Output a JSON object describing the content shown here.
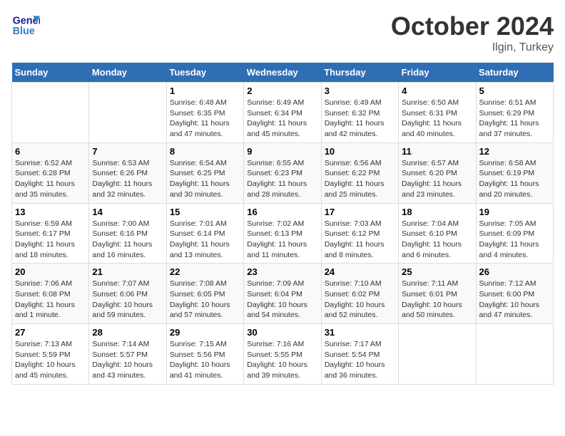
{
  "logo": {
    "line1": "General",
    "line2": "Blue"
  },
  "title": "October 2024",
  "location": "Ilgin, Turkey",
  "days_of_week": [
    "Sunday",
    "Monday",
    "Tuesday",
    "Wednesday",
    "Thursday",
    "Friday",
    "Saturday"
  ],
  "weeks": [
    [
      {
        "day": "",
        "info": ""
      },
      {
        "day": "",
        "info": ""
      },
      {
        "day": "1",
        "info": "Sunrise: 6:48 AM\nSunset: 6:35 PM\nDaylight: 11 hours and 47 minutes."
      },
      {
        "day": "2",
        "info": "Sunrise: 6:49 AM\nSunset: 6:34 PM\nDaylight: 11 hours and 45 minutes."
      },
      {
        "day": "3",
        "info": "Sunrise: 6:49 AM\nSunset: 6:32 PM\nDaylight: 11 hours and 42 minutes."
      },
      {
        "day": "4",
        "info": "Sunrise: 6:50 AM\nSunset: 6:31 PM\nDaylight: 11 hours and 40 minutes."
      },
      {
        "day": "5",
        "info": "Sunrise: 6:51 AM\nSunset: 6:29 PM\nDaylight: 11 hours and 37 minutes."
      }
    ],
    [
      {
        "day": "6",
        "info": "Sunrise: 6:52 AM\nSunset: 6:28 PM\nDaylight: 11 hours and 35 minutes."
      },
      {
        "day": "7",
        "info": "Sunrise: 6:53 AM\nSunset: 6:26 PM\nDaylight: 11 hours and 32 minutes."
      },
      {
        "day": "8",
        "info": "Sunrise: 6:54 AM\nSunset: 6:25 PM\nDaylight: 11 hours and 30 minutes."
      },
      {
        "day": "9",
        "info": "Sunrise: 6:55 AM\nSunset: 6:23 PM\nDaylight: 11 hours and 28 minutes."
      },
      {
        "day": "10",
        "info": "Sunrise: 6:56 AM\nSunset: 6:22 PM\nDaylight: 11 hours and 25 minutes."
      },
      {
        "day": "11",
        "info": "Sunrise: 6:57 AM\nSunset: 6:20 PM\nDaylight: 11 hours and 23 minutes."
      },
      {
        "day": "12",
        "info": "Sunrise: 6:58 AM\nSunset: 6:19 PM\nDaylight: 11 hours and 20 minutes."
      }
    ],
    [
      {
        "day": "13",
        "info": "Sunrise: 6:59 AM\nSunset: 6:17 PM\nDaylight: 11 hours and 18 minutes."
      },
      {
        "day": "14",
        "info": "Sunrise: 7:00 AM\nSunset: 6:16 PM\nDaylight: 11 hours and 16 minutes."
      },
      {
        "day": "15",
        "info": "Sunrise: 7:01 AM\nSunset: 6:14 PM\nDaylight: 11 hours and 13 minutes."
      },
      {
        "day": "16",
        "info": "Sunrise: 7:02 AM\nSunset: 6:13 PM\nDaylight: 11 hours and 11 minutes."
      },
      {
        "day": "17",
        "info": "Sunrise: 7:03 AM\nSunset: 6:12 PM\nDaylight: 11 hours and 8 minutes."
      },
      {
        "day": "18",
        "info": "Sunrise: 7:04 AM\nSunset: 6:10 PM\nDaylight: 11 hours and 6 minutes."
      },
      {
        "day": "19",
        "info": "Sunrise: 7:05 AM\nSunset: 6:09 PM\nDaylight: 11 hours and 4 minutes."
      }
    ],
    [
      {
        "day": "20",
        "info": "Sunrise: 7:06 AM\nSunset: 6:08 PM\nDaylight: 11 hours and 1 minute."
      },
      {
        "day": "21",
        "info": "Sunrise: 7:07 AM\nSunset: 6:06 PM\nDaylight: 10 hours and 59 minutes."
      },
      {
        "day": "22",
        "info": "Sunrise: 7:08 AM\nSunset: 6:05 PM\nDaylight: 10 hours and 57 minutes."
      },
      {
        "day": "23",
        "info": "Sunrise: 7:09 AM\nSunset: 6:04 PM\nDaylight: 10 hours and 54 minutes."
      },
      {
        "day": "24",
        "info": "Sunrise: 7:10 AM\nSunset: 6:02 PM\nDaylight: 10 hours and 52 minutes."
      },
      {
        "day": "25",
        "info": "Sunrise: 7:11 AM\nSunset: 6:01 PM\nDaylight: 10 hours and 50 minutes."
      },
      {
        "day": "26",
        "info": "Sunrise: 7:12 AM\nSunset: 6:00 PM\nDaylight: 10 hours and 47 minutes."
      }
    ],
    [
      {
        "day": "27",
        "info": "Sunrise: 7:13 AM\nSunset: 5:59 PM\nDaylight: 10 hours and 45 minutes."
      },
      {
        "day": "28",
        "info": "Sunrise: 7:14 AM\nSunset: 5:57 PM\nDaylight: 10 hours and 43 minutes."
      },
      {
        "day": "29",
        "info": "Sunrise: 7:15 AM\nSunset: 5:56 PM\nDaylight: 10 hours and 41 minutes."
      },
      {
        "day": "30",
        "info": "Sunrise: 7:16 AM\nSunset: 5:55 PM\nDaylight: 10 hours and 39 minutes."
      },
      {
        "day": "31",
        "info": "Sunrise: 7:17 AM\nSunset: 5:54 PM\nDaylight: 10 hours and 36 minutes."
      },
      {
        "day": "",
        "info": ""
      },
      {
        "day": "",
        "info": ""
      }
    ]
  ]
}
